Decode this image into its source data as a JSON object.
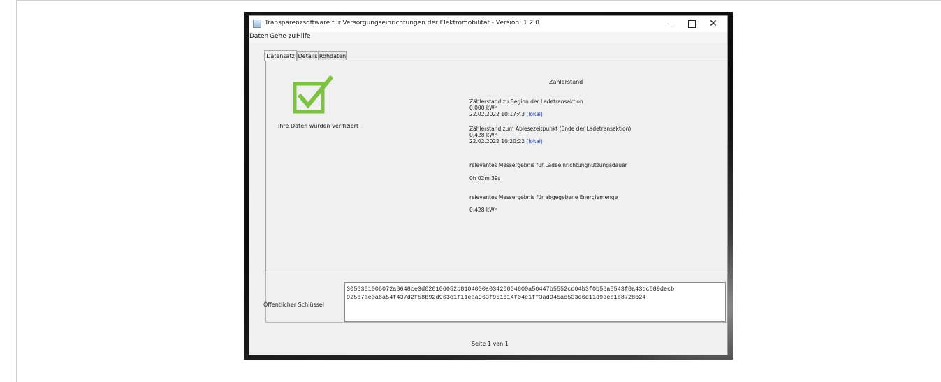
{
  "window": {
    "title": "Transparenzsoftware für Versorgungseinrichtungen der Elektromobilität - Version: 1.2.0",
    "minimize_glyph": "–",
    "close_glyph": "✕"
  },
  "menu": {
    "items": [
      "Daten",
      "Gehe zu",
      "Hilfe"
    ]
  },
  "tabs": [
    {
      "label": "Datensatz",
      "active": true
    },
    {
      "label": "Details",
      "active": false
    },
    {
      "label": "Rohdaten",
      "active": false
    }
  ],
  "verification": {
    "icon": "checkmark-icon",
    "icon_color": "#7dc241",
    "message": "Ihre Daten wurden verifiziert"
  },
  "meter": {
    "heading": "Zählerstand",
    "start": {
      "label": "Zählerstand zu Beginn der Ladetransaktion",
      "value": "0,000 kWh",
      "timestamp": "22.02.2022 10:17:43",
      "timezone_link": "(lokal)"
    },
    "end": {
      "label": "Zählerstand zum Ablesezeitpunkt (Ende der Ladetransaktion)",
      "value": "0,428 kWh",
      "timestamp": "22.02.2022 10:20:22",
      "timezone_link": "(lokal)"
    },
    "duration": {
      "label": "relevantes Messergebnis für Ladeeinrichtungnutzungsdauer",
      "value": "0h 02m 39s"
    },
    "energy": {
      "label": "relevantes Messergebnis für abgegebene Energiemenge",
      "value": "0,428 kWh"
    }
  },
  "public_key": {
    "label": "Öffentlicher Schlüssel",
    "line1": "3056301006072a8648ce3d020106052b8104000a03420004600a50447b5552cd04b3f0b58a8543f8a43dc889decb",
    "line2": "925b7ae0a6a54f437d2f58b92d963c1f11eaa963f951614f04e1ff3ad945ac533e6d11d9deb1b8728b24"
  },
  "pagination": {
    "label": "Seite 1 von 1"
  }
}
